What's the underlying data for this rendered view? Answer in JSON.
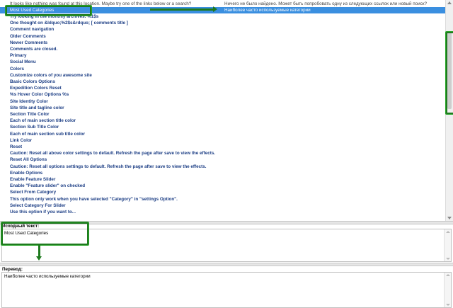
{
  "list": {
    "rows": [
      {
        "source": "It looks like nothing was found at this location. Maybe try one of the links below or a search?",
        "translation": "Ничего не было найдено. Может быть попробовать одну из следующих ссылок или новый поиск?"
      },
      {
        "source": "Most Used Categories",
        "translation": "Наиболее часто используемые категории"
      },
      {
        "source": "Try looking in the monthly archives. %1$s",
        "translation": ""
      },
      {
        "source": "One thought on &ldquo;%2$s&rdquo;  [ comments title ]",
        "translation": ""
      },
      {
        "source": "Comment navigation",
        "translation": ""
      },
      {
        "source": "Older Comments",
        "translation": ""
      },
      {
        "source": "Newer Comments",
        "translation": ""
      },
      {
        "source": "Comments are closed.",
        "translation": ""
      },
      {
        "source": "Primary",
        "translation": ""
      },
      {
        "source": "Social Menu",
        "translation": ""
      },
      {
        "source": "Colors",
        "translation": ""
      },
      {
        "source": "Customize colors of you awesome site",
        "translation": ""
      },
      {
        "source": "Basic Colors Options",
        "translation": ""
      },
      {
        "source": "Expedition Colors Reset",
        "translation": ""
      },
      {
        "source": "%s Hover Color Options %s",
        "translation": ""
      },
      {
        "source": "Site Identity Color",
        "translation": ""
      },
      {
        "source": "Site title and tagline color",
        "translation": ""
      },
      {
        "source": "Section Title Color",
        "translation": ""
      },
      {
        "source": "Each of main section title color",
        "translation": ""
      },
      {
        "source": "Section Sub Title Color",
        "translation": ""
      },
      {
        "source": "Each of main section sub title color",
        "translation": ""
      },
      {
        "source": "Link Color",
        "translation": ""
      },
      {
        "source": "Reset",
        "translation": ""
      },
      {
        "source": "Caution: Reset all above color settings to default. Refresh the page after save to view the effects.",
        "translation": ""
      },
      {
        "source": "Reset All Options",
        "translation": ""
      },
      {
        "source": "Caution: Reset all options settings to default. Refresh the page after save to view the effects.",
        "translation": ""
      },
      {
        "source": "Enable Options",
        "translation": ""
      },
      {
        "source": "Enable Feature Slider",
        "translation": ""
      },
      {
        "source": "Enable \"Feature slider\" on checked",
        "translation": ""
      },
      {
        "source": "Select From Category",
        "translation": ""
      },
      {
        "source": "This option only work when you have selected \"Category\" in \"settings Option\".",
        "translation": ""
      },
      {
        "source": "Select Category For Slider",
        "translation": ""
      },
      {
        "source": "Use this option if you want to...",
        "translation": ""
      }
    ]
  },
  "source_pane": {
    "label": "Исходный текст:",
    "text": "Most Used Categories"
  },
  "translation_pane": {
    "label": "Перевод:",
    "text": "Наиболее часто используемые категории"
  },
  "colors": {
    "selection": "#3a8fe0",
    "annotation": "#1e7a1e"
  }
}
